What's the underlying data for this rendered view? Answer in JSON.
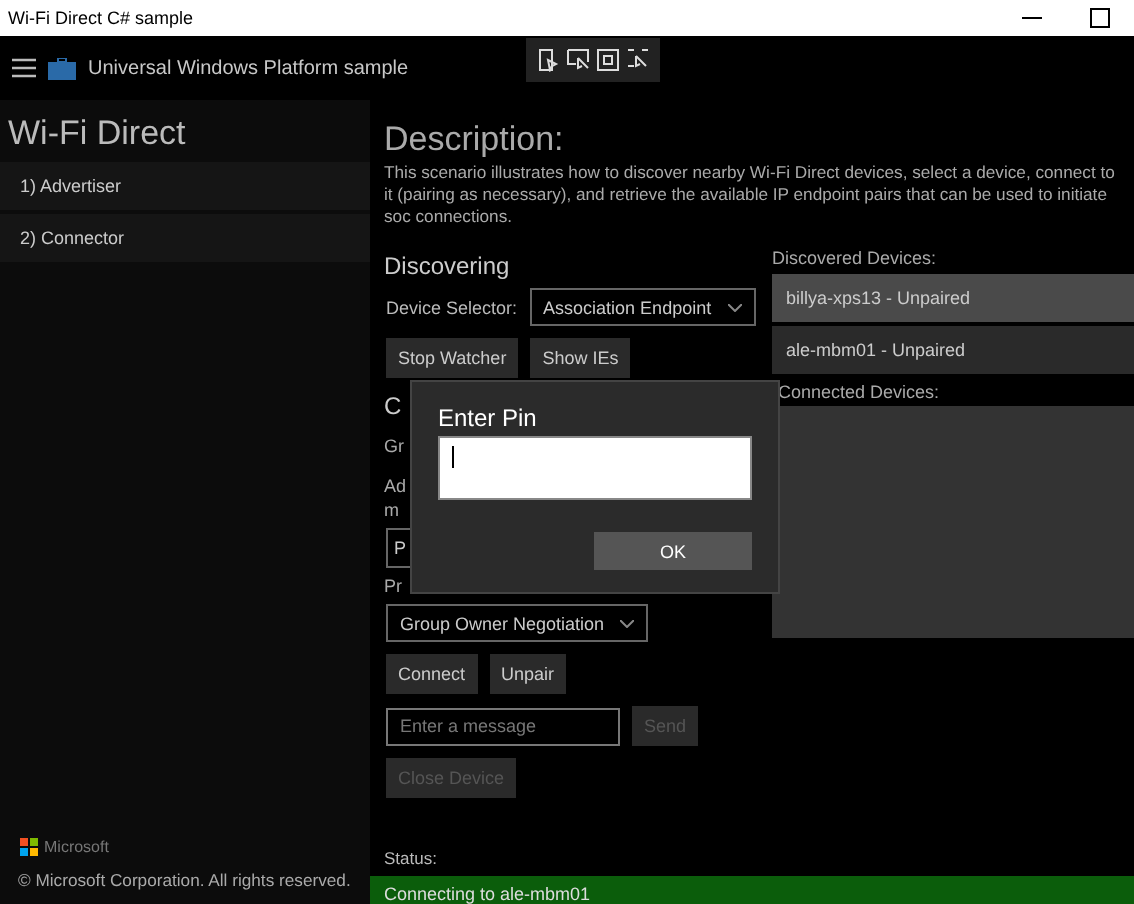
{
  "window": {
    "title": "Wi-Fi Direct C# sample"
  },
  "header": {
    "title": "Universal Windows Platform sample"
  },
  "sidebar": {
    "title": "Wi-Fi Direct",
    "items": [
      {
        "label": "1) Advertiser"
      },
      {
        "label": "2) Connector"
      }
    ],
    "brand": "Microsoft",
    "copyright": "© Microsoft Corporation. All rights reserved."
  },
  "description": {
    "heading": "Description:",
    "text": "This scenario illustrates how to discover nearby Wi-Fi Direct devices, select a device, connect to it (pairing as necessary), and retrieve the available IP endpoint pairs that can be used to initiate soc connections."
  },
  "discovering": {
    "heading": "Discovering",
    "selector_label": "Device Selector:",
    "selector_value": "Association Endpoint",
    "buttons": [
      {
        "label": "Stop Watcher",
        "disabled": false
      },
      {
        "label": "Show IEs",
        "disabled": false
      }
    ]
  },
  "connecting": {
    "heading": "C",
    "lines": [
      "Gr",
      "Ad",
      "m"
    ],
    "button": "P",
    "pairing_label": "Pr",
    "pairing_value": "Group Owner Negotiation",
    "buttons": [
      {
        "label": "Connect",
        "disabled": false
      },
      {
        "label": "Unpair",
        "disabled": false
      }
    ],
    "message": {
      "placeholder": "Enter a message"
    },
    "send": {
      "label": "Send",
      "disabled": true
    },
    "close": {
      "label": "Close Device",
      "disabled": true
    }
  },
  "devices": {
    "discovered_label": "Discovered Devices:",
    "discovered": [
      {
        "label": "billya-xps13 - Unpaired",
        "selected": true
      },
      {
        "label": "ale-mbm01 - Unpaired",
        "selected": false
      }
    ],
    "connected_label": "Connected Devices:"
  },
  "status": {
    "label": "Status:",
    "message": "Connecting to ale-mbm01"
  },
  "dialog": {
    "title": "Enter Pin",
    "button": "OK"
  }
}
